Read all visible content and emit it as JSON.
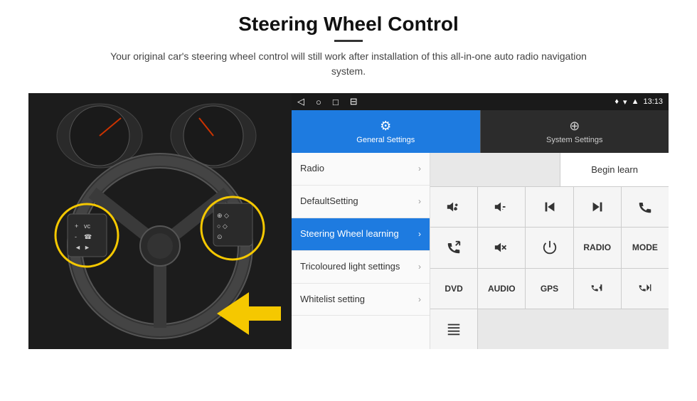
{
  "page": {
    "title": "Steering Wheel Control",
    "subtitle": "Your original car's steering wheel control will still work after installation of this all-in-one auto radio navigation system."
  },
  "status_bar": {
    "time": "13:13",
    "nav_icons": [
      "◁",
      "○",
      "□",
      "⊟"
    ]
  },
  "tabs": {
    "active": {
      "label": "General Settings",
      "icon": "⚙"
    },
    "inactive": {
      "label": "System Settings",
      "icon": "🌐"
    }
  },
  "menu": {
    "items": [
      {
        "label": "Radio",
        "active": false
      },
      {
        "label": "DefaultSetting",
        "active": false
      },
      {
        "label": "Steering Wheel learning",
        "active": true
      },
      {
        "label": "Tricoloured light settings",
        "active": false
      },
      {
        "label": "Whitelist setting",
        "active": false
      }
    ]
  },
  "controls": {
    "begin_learn_label": "Begin learn",
    "rows": [
      [
        {
          "type": "icon",
          "icon": "vol_up",
          "display": "🔊+"
        },
        {
          "type": "icon",
          "icon": "vol_down",
          "display": "🔉-"
        },
        {
          "type": "icon",
          "icon": "prev",
          "display": "⏮"
        },
        {
          "type": "icon",
          "icon": "next",
          "display": "⏭"
        },
        {
          "type": "icon",
          "icon": "phone",
          "display": "📞"
        }
      ],
      [
        {
          "type": "icon",
          "icon": "answer",
          "display": "📲"
        },
        {
          "type": "icon",
          "icon": "mute",
          "display": "🔇"
        },
        {
          "type": "icon",
          "icon": "power",
          "display": "⏻"
        },
        {
          "type": "text",
          "display": "RADIO"
        },
        {
          "type": "text",
          "display": "MODE"
        }
      ],
      [
        {
          "type": "text",
          "display": "DVD"
        },
        {
          "type": "text",
          "display": "AUDIO"
        },
        {
          "type": "text",
          "display": "GPS"
        },
        {
          "type": "icon",
          "icon": "phone_prev",
          "display": "📞⏮"
        },
        {
          "type": "icon",
          "icon": "phone_next",
          "display": "📞⏭"
        }
      ],
      [
        {
          "type": "icon",
          "icon": "list",
          "display": "☰"
        }
      ]
    ]
  }
}
